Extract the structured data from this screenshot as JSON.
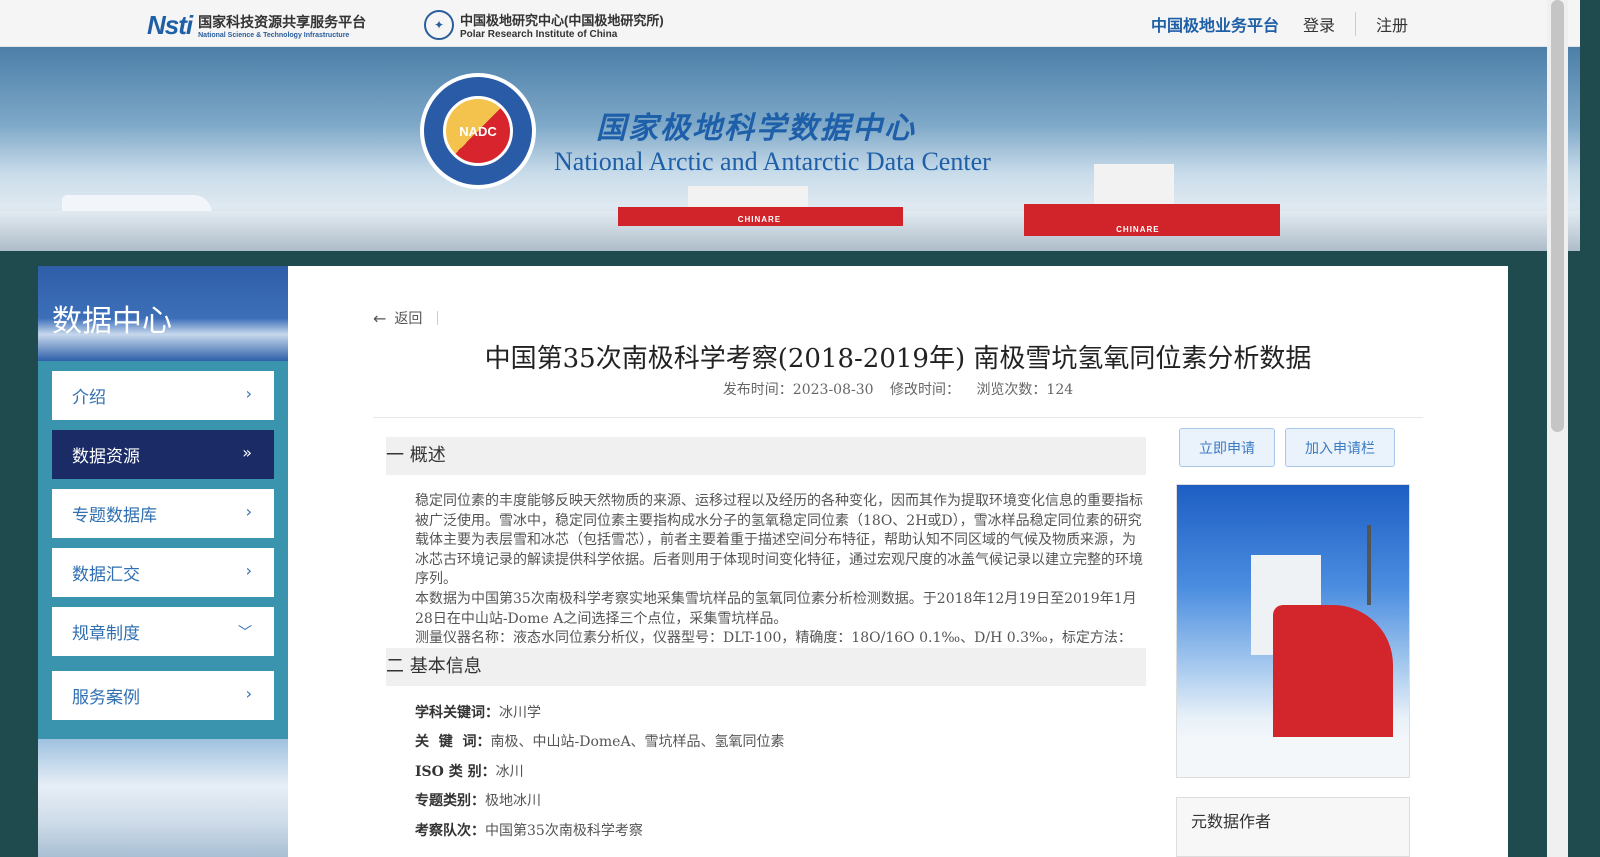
{
  "topbar": {
    "nsti_mark": "Nsti",
    "nsti_cn": "国家科技资源共享服务平台",
    "nsti_en": "National Science & Technology Infrastructure",
    "polar_cn": "中国极地研究中心(中国极地研究所)",
    "polar_en": "Polar Research Institute of China",
    "nav_platform": "中国极地业务平台",
    "nav_login": "登录",
    "nav_register": "注册"
  },
  "banner": {
    "seal_text": "NADC",
    "title_cn": "国家极地科学数据中心",
    "title_en": "National Arctic and Antarctic Data Center",
    "ship_label": "CHINARE"
  },
  "sidebar": {
    "title": "数据中心",
    "items": [
      {
        "label": "介绍",
        "icon": "chevron-right-icon"
      },
      {
        "label": "数据资源",
        "icon": "chevron-double-right-icon",
        "active": true
      },
      {
        "label": "专题数据库",
        "icon": "chevron-right-icon"
      },
      {
        "label": "数据汇交",
        "icon": "chevron-right-icon"
      },
      {
        "label": "规章制度",
        "icon": "chevron-down-icon"
      },
      {
        "label": "服务案例",
        "icon": "chevron-right-icon"
      }
    ]
  },
  "article": {
    "back_label": "返回",
    "title": "中国第35次南极科学考察(2018-2019年) 南极雪坑氢氧同位素分析数据",
    "publish_time": "发布时间：2023-08-30",
    "modify_time": "修改时间：",
    "views": "浏览次数：124",
    "sections": {
      "overview_title": "一 概述",
      "basic_title": "二 基本信息"
    },
    "overview_paragraphs": [
      "稳定同位素的丰度能够反映天然物质的来源、运移过程以及经历的各种变化，因而其作为提取环境变化信息的重要指标被广泛使用。雪冰中，稳定同位素主要指构成水分子的氢氧稳定同位素（18O、2H或D），雪冰样品稳定同位素的研究载体主要为表层雪和冰芯（包括雪芯），前者主要着重于描述空间分布特征，帮助认知不同区域的气候及物质来源，为冰芯古环境记录的解读提供科学依据。后者则用于体现时间变化特征，通过宏观尺度的冰盖气候记录以建立完整的环境序列。",
      "本数据为中国第35次南极科学考察实地采集雪坑样品的氢氧同位素分析检测数据。于2018年12月19日至2019年1月28日在中山站-Dome A之间选择三个点位，采集雪坑样品。",
      "测量仪器名称：液态水同位素分析仪，仪器型号：DLT-100，精确度：18O/16O 0.1‰、D/H 0.3‰，标定方法：外标法。"
    ],
    "basic_info": [
      {
        "key": "学科关键词：",
        "value": "冰川学"
      },
      {
        "key": "关  键  词：",
        "value": "南极、中山站-DomeA、雪坑样品、氢氧同位素"
      },
      {
        "key": "ISO 类 别：",
        "value": "冰川"
      },
      {
        "key": "专题类别：",
        "value": "极地冰川"
      },
      {
        "key": "考察队次：",
        "value": "中国第35次南极科学考察"
      }
    ]
  },
  "actions": {
    "apply_label": "立即申请",
    "cart_label": "加入申请栏"
  },
  "right_panel": {
    "author_title": "元数据作者"
  }
}
